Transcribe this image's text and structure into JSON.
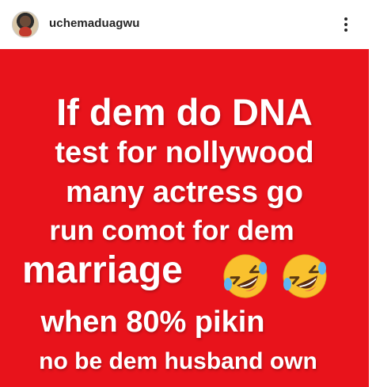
{
  "header": {
    "username": "uchemaduagwu",
    "more_icon": "more-vertical-icon"
  },
  "post": {
    "background_color": "#e8131b",
    "lines": [
      "If dem do DNA",
      "test for nollywood",
      "many actress go",
      "run comot for dem",
      "marriage",
      "when 80% pikin",
      "no be dem husband own"
    ],
    "emoji": [
      "rolling-on-floor-laughing",
      "rolling-on-floor-laughing"
    ]
  }
}
